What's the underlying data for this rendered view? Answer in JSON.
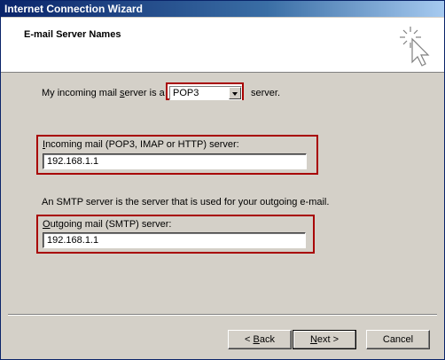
{
  "window": {
    "title": "Internet Connection Wizard"
  },
  "header": {
    "heading": "E-mail Server Names",
    "icon": "wizard-cursor-sparkle-icon"
  },
  "incoming_type": {
    "label_prefix": "My incoming mail ",
    "label_accel": "s",
    "label_suffix": "erver is a",
    "selected": "POP3",
    "after_label": "server."
  },
  "incoming_server": {
    "label_accel": "I",
    "label_rest": "ncoming mail (POP3, IMAP or HTTP) server:",
    "value": "192.168.1.1"
  },
  "smtp_description": "An SMTP server is the server that is used for your outgoing e-mail.",
  "outgoing_server": {
    "label_accel": "O",
    "label_rest": "utgoing mail (SMTP) server:",
    "value": "192.168.1.1"
  },
  "buttons": {
    "back_prefix": "< ",
    "back_accel": "B",
    "back_rest": "ack",
    "next_accel": "N",
    "next_rest": "ext >",
    "cancel": "Cancel"
  },
  "colors": {
    "highlight_border": "#a80000",
    "titlebar": "#0a246a",
    "dialog_bg": "#d4d0c8"
  }
}
